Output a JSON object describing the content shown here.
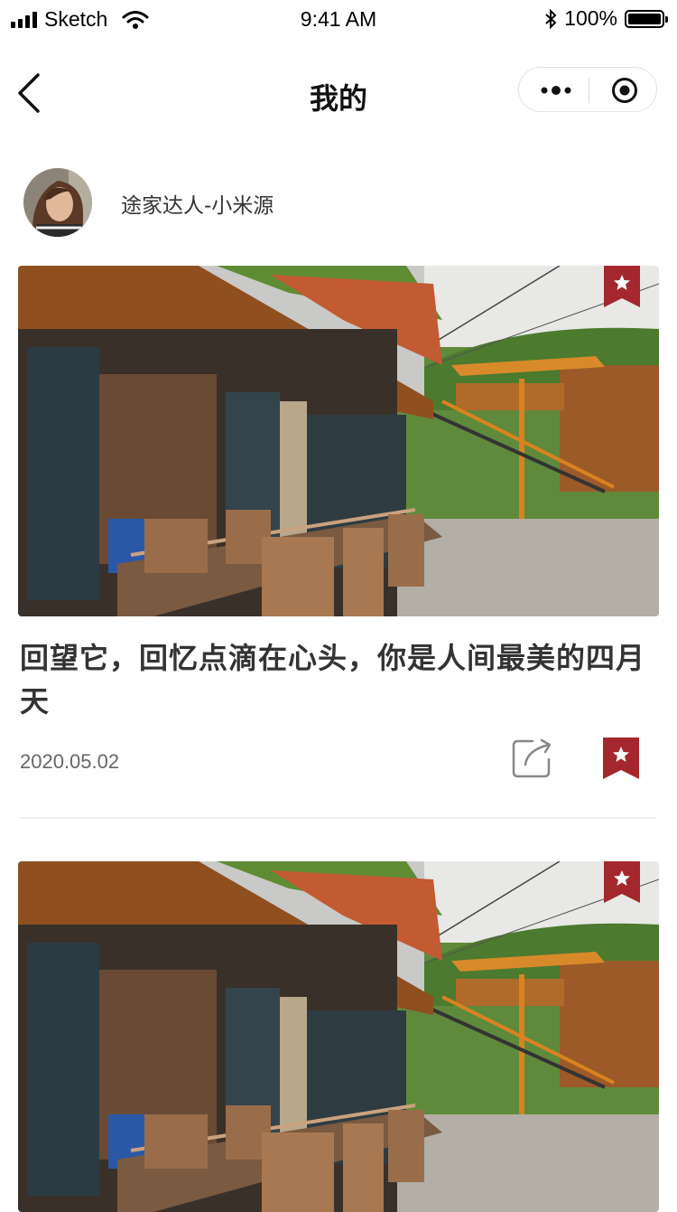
{
  "status_bar": {
    "carrier": "Sketch",
    "time": "9:41 AM",
    "battery": "100%"
  },
  "nav": {
    "title": "我的",
    "back_icon": "chevron-left-icon",
    "more_icon": "more-dots-icon",
    "close_icon": "target-circle-icon"
  },
  "user": {
    "name": "途家达人-小米源"
  },
  "articles": [
    {
      "title": "回望它，回忆点滴在心头，你是人间最美的四月天",
      "date": "2020.05.02",
      "favorited": true
    },
    {
      "favorited": true
    }
  ],
  "colors": {
    "accent": "#a3272d",
    "text": "#333333",
    "muted": "#666666"
  }
}
